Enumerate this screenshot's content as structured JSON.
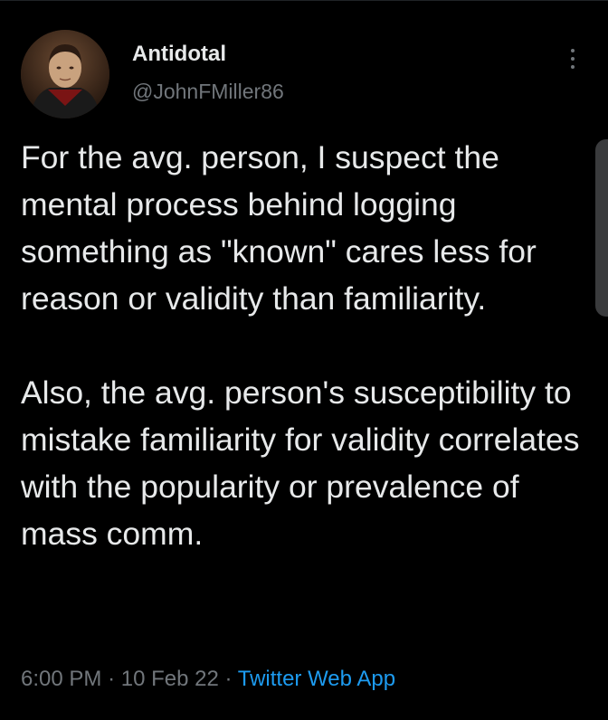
{
  "author": {
    "display_name": "Antidotal",
    "handle": "@JohnFMiller86"
  },
  "tweet": {
    "paragraphs": [
      "For the avg. person, I suspect the mental process behind logging something as \"known\" cares less for reason or validity than familiarity.",
      "Also, the avg. person's susceptibility to mistake familiarity for validity correlates with the popularity or prevalence of mass comm."
    ],
    "time": "6:00 PM",
    "date": "10 Feb 22",
    "separator": "·",
    "source": "Twitter Web App"
  },
  "icons": {
    "more": "more-vertical-icon"
  },
  "colors": {
    "background": "#000000",
    "text": "#e7e9ea",
    "secondary": "#71767b",
    "link": "#1d9bf0"
  }
}
